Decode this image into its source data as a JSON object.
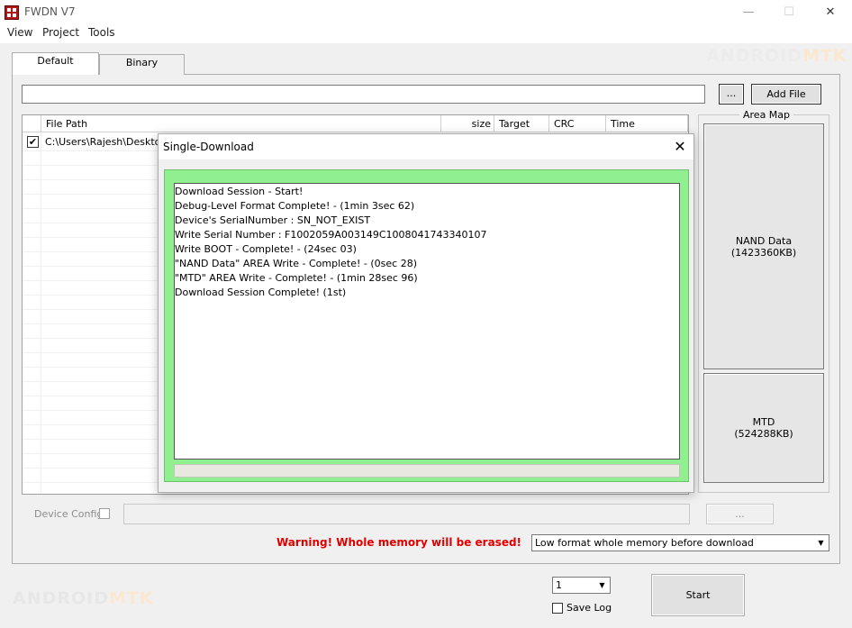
{
  "window": {
    "title": "FWDN V7",
    "controls": {
      "minimize": "—",
      "maximize": "☐",
      "close": "✕"
    }
  },
  "menu": [
    "View",
    "Project",
    "Tools"
  ],
  "tabs": [
    {
      "label": "Default",
      "active": true
    },
    {
      "label": "Binary",
      "active": false
    }
  ],
  "toolbar": {
    "path_value": "",
    "browse_label": "...",
    "add_file_label": "Add File"
  },
  "file_table": {
    "columns": [
      "File Path",
      "size",
      "Target",
      "CRC",
      "Time"
    ],
    "rows": [
      {
        "checked": true,
        "path": "C:\\Users\\Rajesh\\Desktop\\"
      }
    ]
  },
  "area_map": {
    "title": "Area Map",
    "blocks": [
      {
        "name": "NAND Data",
        "size": "(1423360KB)"
      },
      {
        "name": "MTD",
        "size": "(524288KB)"
      }
    ]
  },
  "device_config": {
    "label": "Device Config",
    "checked": false,
    "value": "",
    "button_label": "..."
  },
  "warning": "Warning! Whole memory will be erased!",
  "format_option": "Low format whole memory before download",
  "download_count": "1",
  "save_log": {
    "label": "Save Log",
    "checked": false
  },
  "start_label": "Start",
  "watermark": {
    "part1": "ANDROID",
    "part2": "MTK"
  },
  "dialog": {
    "title": "Single-Download",
    "close": "✕",
    "log": [
      "Download Session - Start!",
      "Debug-Level Format Complete! - (1min 3sec 62)",
      "Device's SerialNumber : SN_NOT_EXIST",
      "Write Serial Number : F1002059A003149C1008041743340107",
      "Write BOOT - Complete! - (24sec 03)",
      "\"NAND Data\" AREA Write - Complete! - (0sec 28)",
      "\"MTD\" AREA Write - Complete! - (1min 28sec 96)",
      "Download Session Complete! (1st)"
    ],
    "progress": 0
  },
  "colors": {
    "warning": "#e00000",
    "dialog_frame": "#90f090",
    "progress": "#06b025"
  }
}
